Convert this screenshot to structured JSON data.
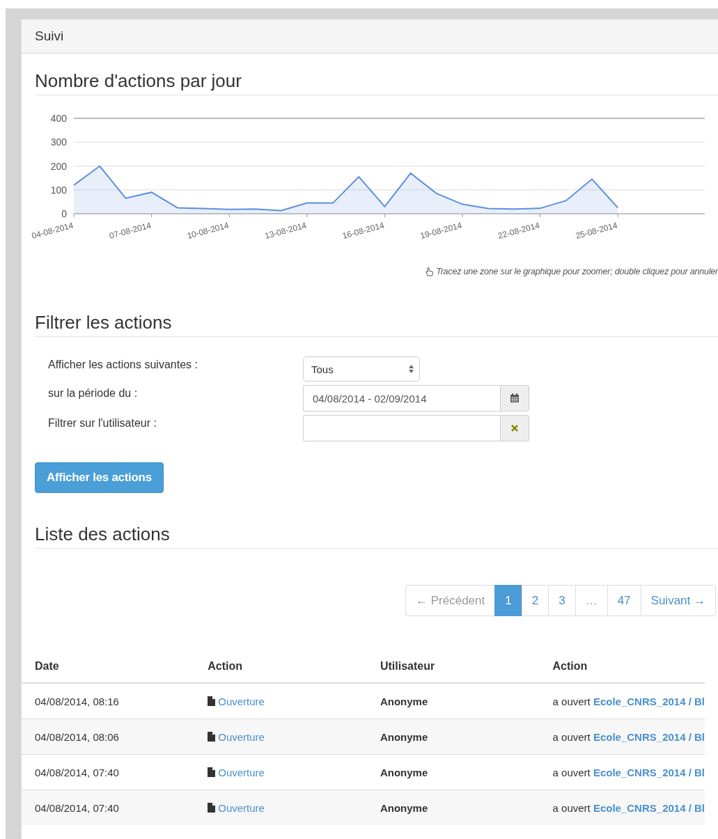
{
  "panel": {
    "title": "Suivi"
  },
  "chart_section": {
    "heading": "Nombre d'actions par jour",
    "hint": "Tracez une zone sur le graphique pour zoomer; double cliquez pour annuler",
    "chart_data": {
      "type": "area",
      "grid": true,
      "categories": [
        "04-08-2014",
        null,
        null,
        "07-08-2014",
        null,
        null,
        "10-08-2014",
        null,
        null,
        "13-08-2014",
        null,
        null,
        "16-08-2014",
        null,
        null,
        "19-08-2014",
        null,
        null,
        "22-08-2014",
        null,
        null,
        "25-08-2014"
      ],
      "series": [
        {
          "color": "#5b8fe0",
          "values": [
            120,
            200,
            65,
            90,
            25,
            22,
            18,
            20,
            13,
            45,
            45,
            155,
            30,
            170,
            85,
            40,
            22,
            20,
            23,
            55,
            145,
            25
          ]
        }
      ],
      "ylim": [
        0,
        400
      ],
      "yticks": [
        0,
        100,
        200,
        300,
        400
      ]
    }
  },
  "filter_section": {
    "heading": "Filtrer les actions",
    "fields": [
      {
        "kind": "select",
        "label": "Afficher les actions suivantes :",
        "value": "Tous"
      },
      {
        "kind": "date",
        "label": "sur la période du :",
        "value": "04/08/2014 - 02/09/2014"
      },
      {
        "kind": "user",
        "label": "Filtrer sur l'utilisateur :"
      }
    ],
    "submit": "Afficher les actions"
  },
  "list_section": {
    "heading": "Liste des actions",
    "pagination": [
      {
        "label": "← Précédent",
        "selected": false,
        "disabled": true
      },
      {
        "label": "1",
        "selected": true,
        "disabled": false
      },
      {
        "label": "2",
        "selected": false,
        "disabled": false
      },
      {
        "label": "3",
        "selected": false,
        "disabled": false
      },
      {
        "label": "…",
        "selected": false,
        "disabled": true
      },
      {
        "label": "47",
        "selected": false,
        "disabled": false
      },
      {
        "label": "Suivant →",
        "selected": false,
        "disabled": false
      }
    ],
    "table": {
      "columns": [
        "Date",
        "Action",
        "Utilisateur",
        "Action"
      ],
      "rows": [
        {
          "date": "04/08/2014, 08:16",
          "action": "Ouverture",
          "user": "Anonyme",
          "detail_prefix": "a ouvert",
          "detail_link": "Ecole_CNRS_2014 / Bl"
        },
        {
          "date": "04/08/2014, 08:06",
          "action": "Ouverture",
          "user": "Anonyme",
          "detail_prefix": "a ouvert",
          "detail_link": "Ecole_CNRS_2014 / Bl"
        },
        {
          "date": "04/08/2014, 07:40",
          "action": "Ouverture",
          "user": "Anonyme",
          "detail_prefix": "a ouvert",
          "detail_link": "Ecole_CNRS_2014 / Bl"
        },
        {
          "date": "04/08/2014, 07:40",
          "action": "Ouverture",
          "user": "Anonyme",
          "detail_prefix": "a ouvert",
          "detail_link": "Ecole_CNRS_2014 / Bl"
        }
      ]
    }
  }
}
